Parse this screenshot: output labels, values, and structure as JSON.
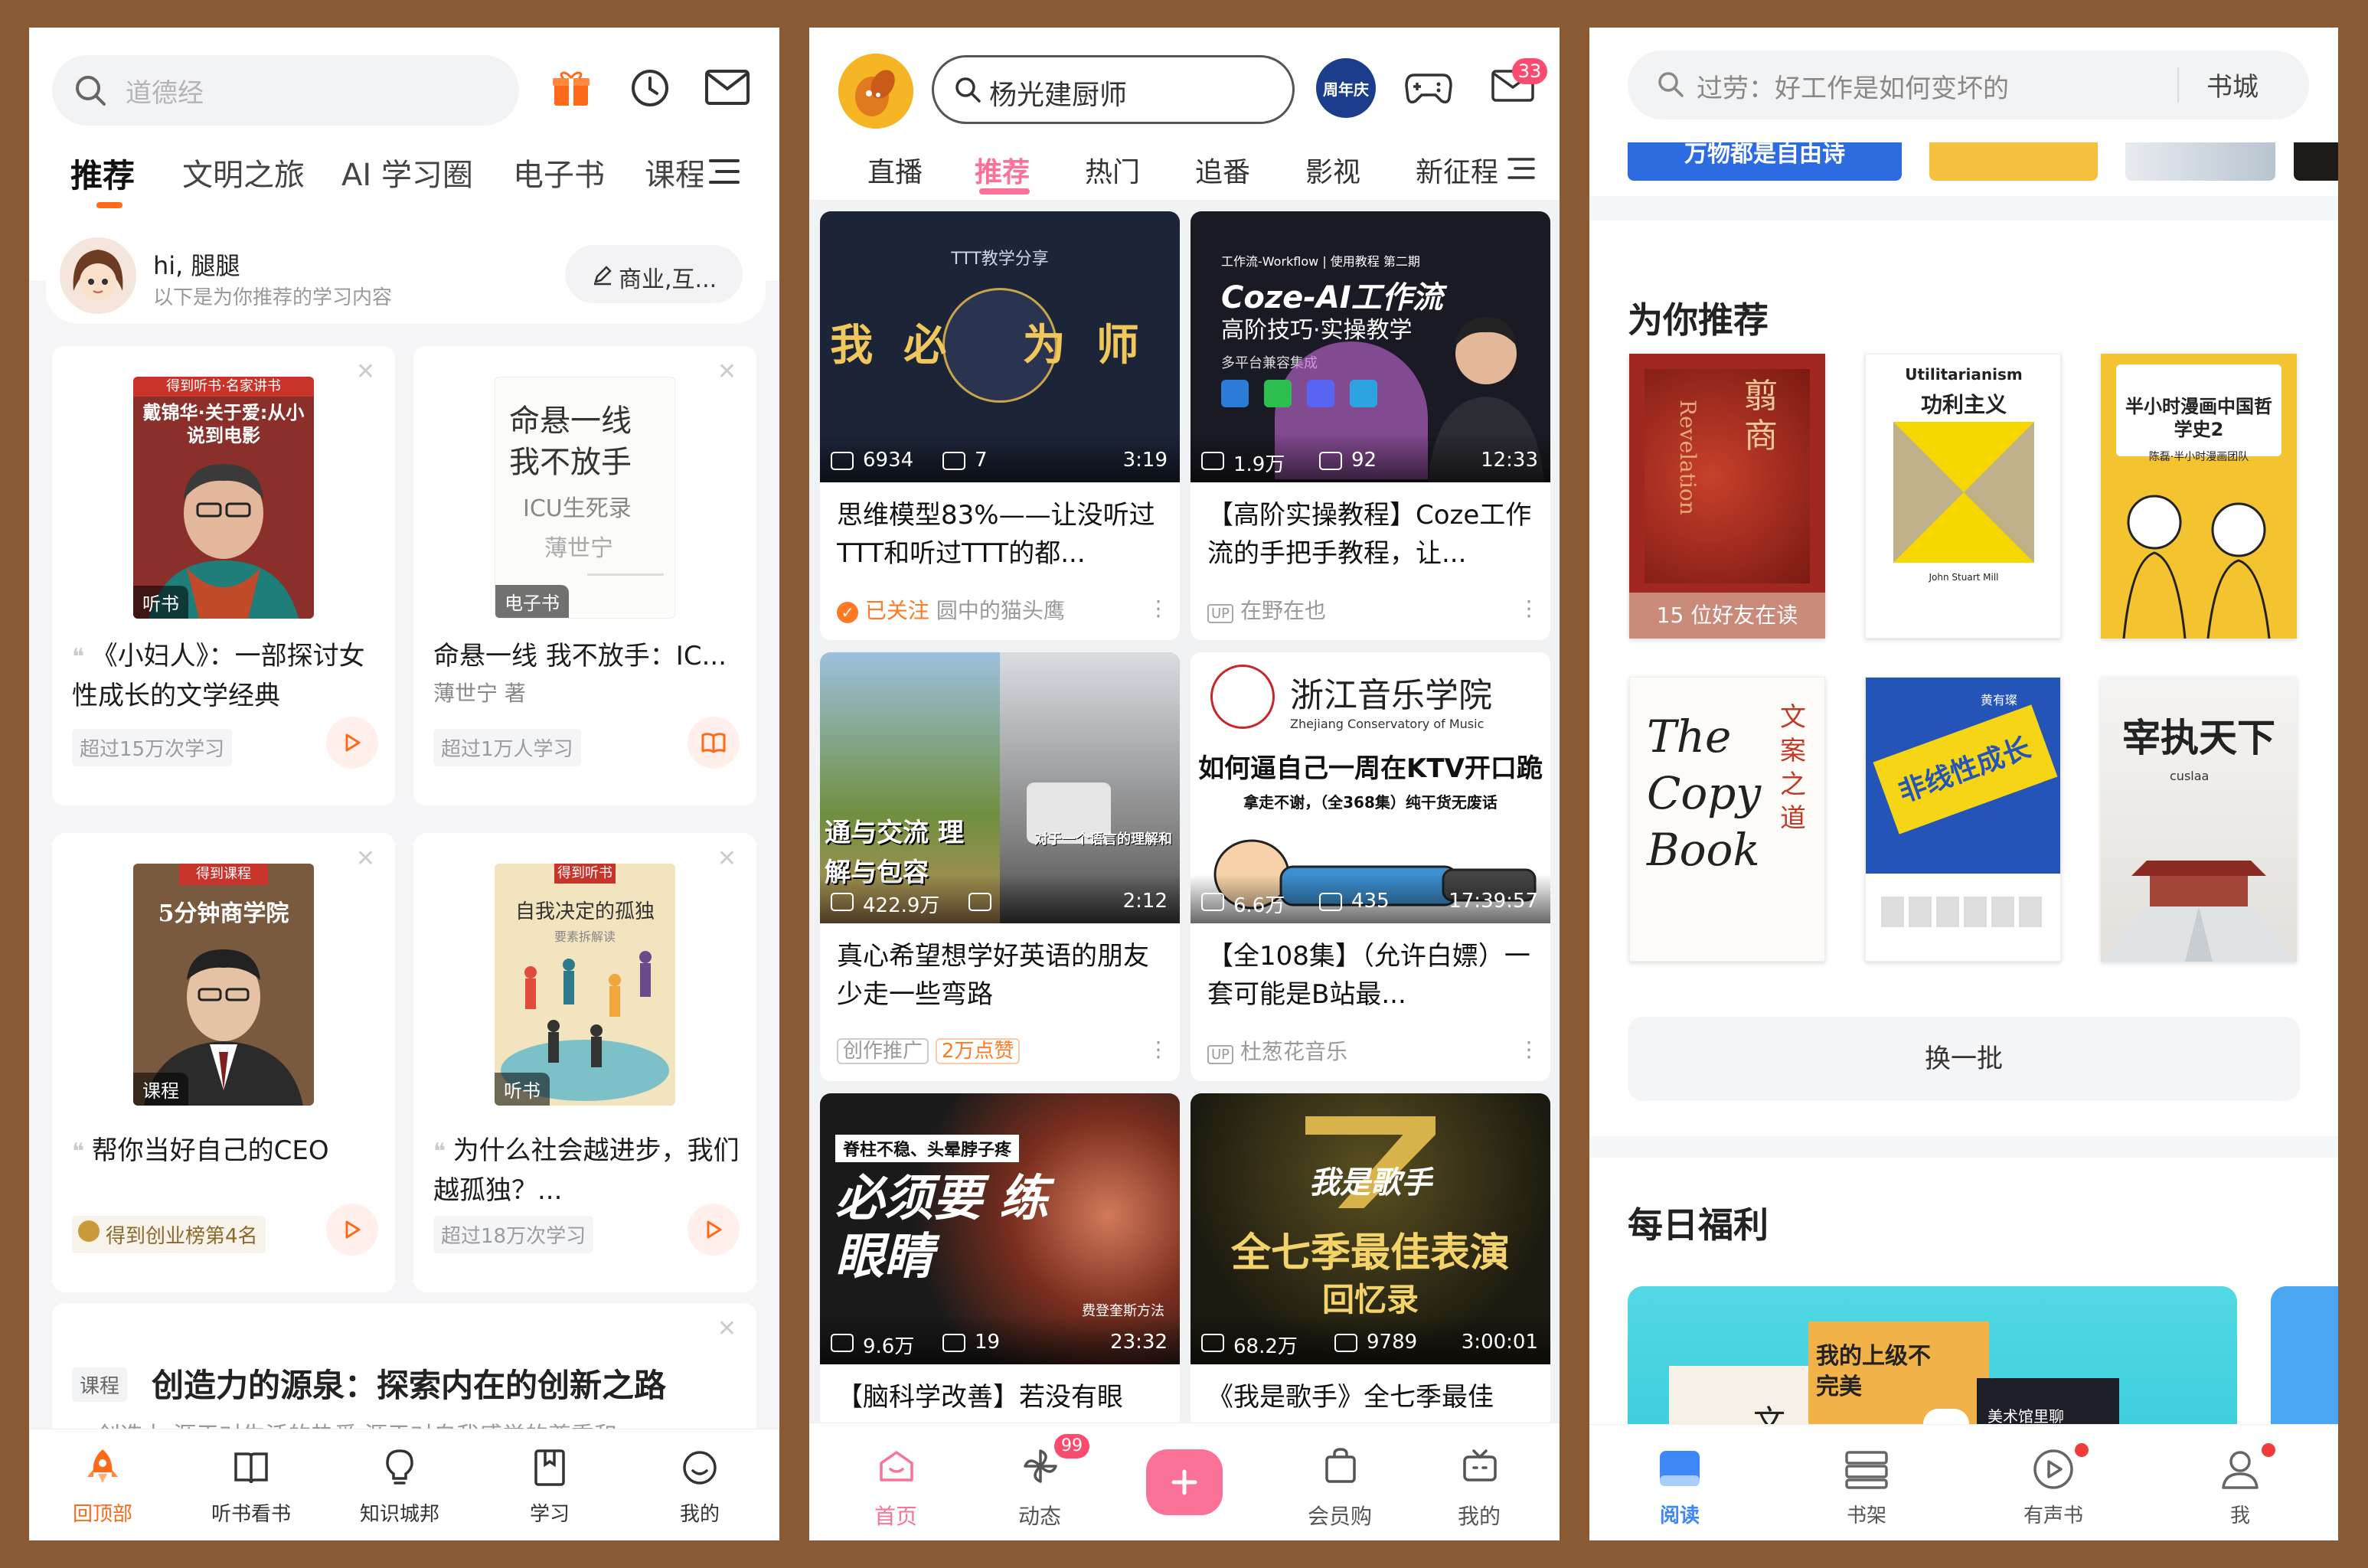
{
  "p1": {
    "search_placeholder": "道德经",
    "tabs": [
      "推荐",
      "文明之旅",
      "AI 学习圈",
      "电子书",
      "课程"
    ],
    "greeting": {
      "name": "hi, 腿腿",
      "sub": "以下是为你推荐的学习内容",
      "chip": "商业,互..."
    },
    "cards": [
      {
        "cover_top": "得到听书·名家讲书",
        "cover_title": "戴锦华·关于爱:从小说到电影",
        "badge": "听书",
        "title": "《小妇人》：一部探讨女性成长的文学经典",
        "tag": "超过15万次学习",
        "action": "play"
      },
      {
        "cover_title": "命悬一线 我不放手",
        "cover_sub": "ICU生死录",
        "cover_author": "薄世宁",
        "badge": "电子书",
        "title": "命悬一线 我不放手：IC...",
        "author": "薄世宁 著",
        "tag": "超过1万人学习",
        "action": "read"
      },
      {
        "cover_top": "得到课程",
        "cover_title": "5分钟商学院",
        "badge": "课程",
        "title": "帮你当好自己的CEO",
        "tag": "得到创业榜第4名",
        "action": "play"
      },
      {
        "cover_top": "得到听书",
        "cover_title": "自我决定的孤独",
        "cover_sub": "要素拆解读",
        "badge": "听书",
        "title": "为什么社会越进步，我们越孤独？...",
        "tag": "超过18万次学习",
        "action": "play"
      }
    ],
    "course": {
      "tag": "课程",
      "title": "创造力的源泉：探索内在的创新之路",
      "sub": "创造力 源于对生活的热爱 源于对自我感觉的尊重和"
    },
    "nav": [
      "回顶部",
      "听书看书",
      "知识城邦",
      "学习",
      "我的"
    ]
  },
  "p2": {
    "search_text": "杨光建厨师",
    "anniv": "周年庆",
    "msg_badge": "33",
    "tabs": [
      "直播",
      "推荐",
      "热门",
      "追番",
      "影视",
      "新征程"
    ],
    "videos": [
      {
        "thumb_title": "我必 为师",
        "thumb_sub": "TTT教学分享",
        "views": "6934",
        "danmaku": "7",
        "duration": "3:19",
        "title": "思维模型83%——让没听过TTT和听过TTT的都...",
        "followed": "已关注",
        "up": "圆中的猫头鹰"
      },
      {
        "thumb_title": "Coze-AI工作流",
        "thumb_sub": "高阶技巧·实操教学",
        "thumb_top": "工作流-Workflow | 使用教程 第二期",
        "thumb_note": "多平台兼容集成",
        "views": "1.9万",
        "danmaku": "92",
        "duration": "12:33",
        "title": "【高阶实操教程】Coze工作流的手把手教程，让...",
        "up": "在野在也"
      },
      {
        "thumb_title": "通与交流 理解与包容",
        "thumb_note": "对于一个语言的理解和",
        "views": "422.9万",
        "danmaku": "",
        "duration": "2:12",
        "title": "真心希望想学好英语的朋友少走一些弯路",
        "up": "创作推广",
        "like": "2万点赞"
      },
      {
        "thumb_title": "如何逼自己一周在KTV开口跪",
        "thumb_top": "浙江音乐学院",
        "thumb_en": "Zhejiang Conservatory of Music",
        "thumb_sub": "拿走不谢，（全368集）纯干货无废话",
        "views": "6.6万",
        "danmaku": "435",
        "duration": "17:39:57",
        "title": "【全108集】（允许白嫖）一套可能是B站最...",
        "up": "杜葱花音乐"
      },
      {
        "thumb_top": "脊柱不稳、头晕脖子疼",
        "thumb_title": "必须要 练眼睛",
        "thumb_note": "费登奎斯方法",
        "views": "9.6万",
        "danmaku": "19",
        "duration": "23:32",
        "title": "【脑科学改善】若没有眼"
      },
      {
        "thumb_top": "我是歌手",
        "thumb_title": "全七季最佳表演",
        "thumb_sub": "回忆录",
        "views": "68.2万",
        "danmaku": "9789",
        "duration": "3:00:01",
        "title": "《我是歌手》全七季最佳"
      }
    ],
    "nav": [
      "首页",
      "动态",
      "",
      "会员购",
      "我的"
    ],
    "nav_badge": "99"
  },
  "p3": {
    "search_text": "过劳：好工作是如何变坏的",
    "search_right": "书城",
    "banner_text": "万物都是自由诗",
    "rec_title": "为你推荐",
    "books": [
      {
        "title": "翦商",
        "en": "Revelation",
        "note": "15 位好友在读"
      },
      {
        "title": "功利主义",
        "en": "Utilitarianism",
        "author": "John Stuart Mill"
      },
      {
        "title": "半小时漫画中国哲学史2",
        "author": "陈磊·半小时漫画团队"
      },
      {
        "title": "文案之道",
        "en": "The Copy Book"
      },
      {
        "title": "非线性成长",
        "author": "黄有璨"
      },
      {
        "title": "宰执天下",
        "author": "cuslaa"
      }
    ],
    "refresh": "换一批",
    "daily_title": "每日福利",
    "promo": [
      "我的上级不完美",
      "美术馆里聊",
      "文心"
    ],
    "nav": [
      "阅读",
      "书架",
      "有声书",
      "我"
    ]
  }
}
